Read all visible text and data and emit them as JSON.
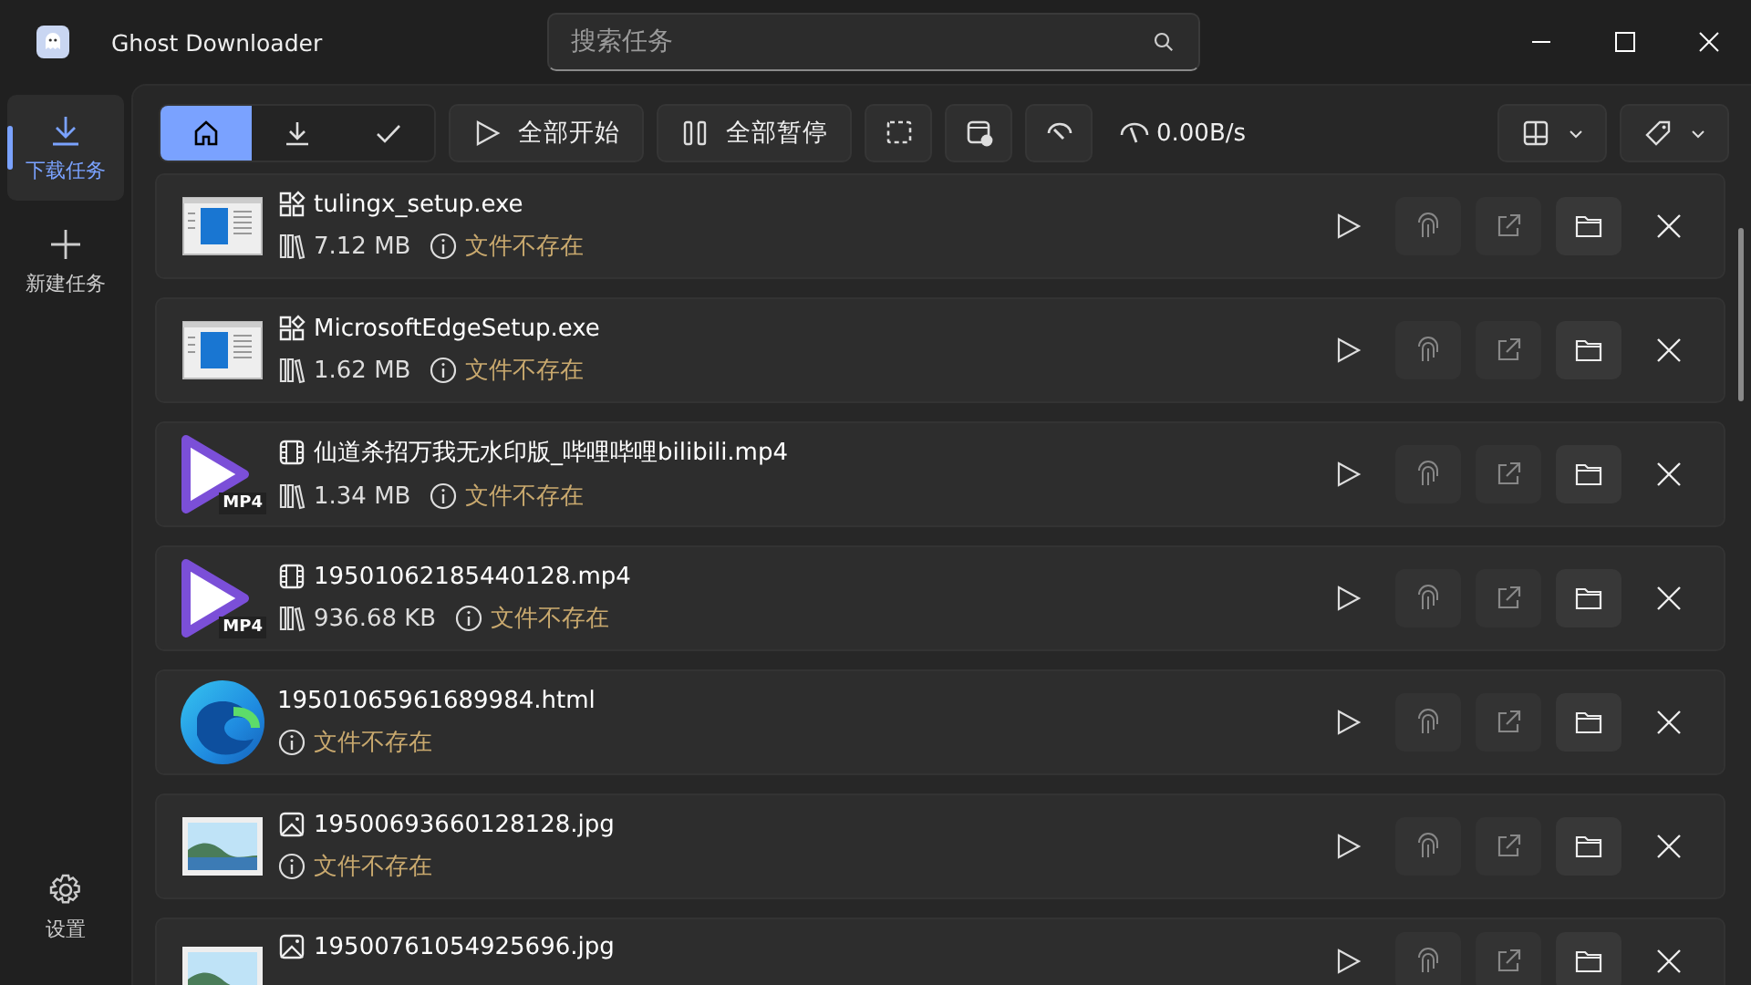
{
  "window": {
    "title": "Ghost Downloader"
  },
  "search": {
    "placeholder": "搜索任务"
  },
  "sidebar": {
    "items": [
      {
        "label": "下载任务",
        "kind": "download",
        "selected": true
      },
      {
        "label": "新建任务",
        "kind": "add",
        "selected": false
      }
    ],
    "settings": {
      "label": "设置"
    }
  },
  "toolbar": {
    "filters": [
      {
        "kind": "home",
        "selected": true
      },
      {
        "kind": "download",
        "selected": false
      },
      {
        "kind": "done",
        "selected": false
      }
    ],
    "start_all": "全部开始",
    "pause_all": "全部暂停",
    "speed": "0.00B/s"
  },
  "tasks": [
    {
      "kind": "exe",
      "name": "tulingx_setup.exe",
      "size": "7.12 MB",
      "status": "文件不存在"
    },
    {
      "kind": "exe",
      "name": "MicrosoftEdgeSetup.exe",
      "size": "1.62 MB",
      "status": "文件不存在"
    },
    {
      "kind": "video",
      "badge": "MP4",
      "name": "仙道杀招万我无水印版_哔哩哔哩bilibili.mp4",
      "size": "1.34 MB",
      "status": "文件不存在"
    },
    {
      "kind": "video",
      "badge": "MP4",
      "name": "19501062185440128.mp4",
      "size": "936.68 KB",
      "status": "文件不存在"
    },
    {
      "kind": "web",
      "name": "19501065961689984.html",
      "status": "文件不存在"
    },
    {
      "kind": "image",
      "name": "19500693660128128.jpg",
      "status": "文件不存在"
    },
    {
      "kind": "image",
      "name": "19500761054925696.jpg"
    }
  ]
}
